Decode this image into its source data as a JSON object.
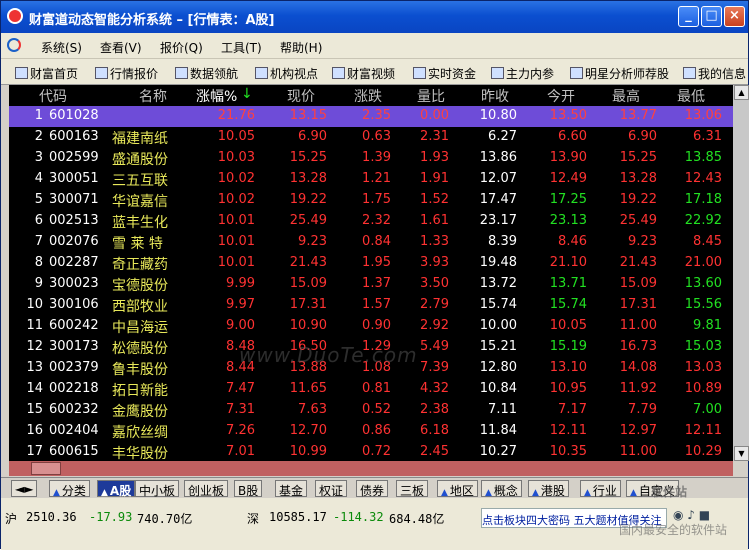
{
  "window": {
    "title": "财富道动态智能分析系统 – [行情表：A股]",
    "buttons": [
      "_",
      "□",
      "×"
    ]
  },
  "menu": [
    "系统(S)",
    "查看(V)",
    "报价(Q)",
    "工具(T)",
    "帮助(H)"
  ],
  "toolbar": [
    "财富首页",
    "行情报价",
    "数据领航",
    "机构视点",
    "财富视频",
    "实时资金",
    "主力内参",
    "明星分析师荐股",
    "我的信息"
  ],
  "table": {
    "headers": [
      "代码",
      "名称",
      "涨幅%",
      "↓",
      "现价",
      "涨跌",
      "量比",
      "昨收",
      "今开",
      "最高",
      "最低"
    ],
    "rows": [
      {
        "idx": "1",
        "code": "601028",
        "name": "",
        "pct": "21.76",
        "price": "13.15",
        "chg": "2.35",
        "vol": "0.00",
        "prev": "10.80",
        "open": "13.50",
        "high": "13.77",
        "low": "13.06",
        "oc": "red",
        "hc": "red",
        "lc": "red"
      },
      {
        "idx": "2",
        "code": "600163",
        "name": "福建南纸",
        "pct": "10.05",
        "price": "6.90",
        "chg": "0.63",
        "vol": "2.31",
        "prev": "6.27",
        "open": "6.60",
        "high": "6.90",
        "low": "6.31",
        "oc": "red",
        "hc": "red",
        "lc": "red"
      },
      {
        "idx": "3",
        "code": "002599",
        "name": "盛通股份",
        "pct": "10.03",
        "price": "15.25",
        "chg": "1.39",
        "vol": "1.93",
        "prev": "13.86",
        "open": "13.90",
        "high": "15.25",
        "low": "13.85",
        "oc": "red",
        "hc": "red",
        "lc": "green"
      },
      {
        "idx": "4",
        "code": "300051",
        "name": "三五互联",
        "pct": "10.02",
        "price": "13.28",
        "chg": "1.21",
        "vol": "1.91",
        "prev": "12.07",
        "open": "12.49",
        "high": "13.28",
        "low": "12.43",
        "oc": "red",
        "hc": "red",
        "lc": "red"
      },
      {
        "idx": "5",
        "code": "300071",
        "name": "华谊嘉信",
        "pct": "10.02",
        "price": "19.22",
        "chg": "1.75",
        "vol": "1.52",
        "prev": "17.47",
        "open": "17.25",
        "high": "19.22",
        "low": "17.18",
        "oc": "green",
        "hc": "red",
        "lc": "green"
      },
      {
        "idx": "6",
        "code": "002513",
        "name": "蓝丰生化",
        "pct": "10.01",
        "price": "25.49",
        "chg": "2.32",
        "vol": "1.61",
        "prev": "23.17",
        "open": "23.13",
        "high": "25.49",
        "low": "22.92",
        "oc": "green",
        "hc": "red",
        "lc": "green"
      },
      {
        "idx": "7",
        "code": "002076",
        "name": "雪 莱 特",
        "pct": "10.01",
        "price": "9.23",
        "chg": "0.84",
        "vol": "1.33",
        "prev": "8.39",
        "open": "8.46",
        "high": "9.23",
        "low": "8.45",
        "oc": "red",
        "hc": "red",
        "lc": "red"
      },
      {
        "idx": "8",
        "code": "002287",
        "name": "奇正藏药",
        "pct": "10.01",
        "price": "21.43",
        "chg": "1.95",
        "vol": "3.93",
        "prev": "19.48",
        "open": "21.10",
        "high": "21.43",
        "low": "21.00",
        "oc": "red",
        "hc": "red",
        "lc": "red"
      },
      {
        "idx": "9",
        "code": "300023",
        "name": "宝德股份",
        "pct": "9.99",
        "price": "15.09",
        "chg": "1.37",
        "vol": "3.50",
        "prev": "13.72",
        "open": "13.71",
        "high": "15.09",
        "low": "13.60",
        "oc": "green",
        "hc": "red",
        "lc": "green"
      },
      {
        "idx": "10",
        "code": "300106",
        "name": "西部牧业",
        "pct": "9.97",
        "price": "17.31",
        "chg": "1.57",
        "vol": "2.79",
        "prev": "15.74",
        "open": "15.74",
        "high": "17.31",
        "low": "15.56",
        "oc": "green",
        "hc": "red",
        "lc": "green"
      },
      {
        "idx": "11",
        "code": "600242",
        "name": "中昌海运",
        "pct": "9.00",
        "price": "10.90",
        "chg": "0.90",
        "vol": "2.92",
        "prev": "10.00",
        "open": "10.05",
        "high": "11.00",
        "low": "9.81",
        "oc": "red",
        "hc": "red",
        "lc": "green"
      },
      {
        "idx": "12",
        "code": "300173",
        "name": "松德股份",
        "pct": "8.48",
        "price": "16.50",
        "chg": "1.29",
        "vol": "5.49",
        "prev": "15.21",
        "open": "15.19",
        "high": "16.73",
        "low": "15.03",
        "oc": "green",
        "hc": "red",
        "lc": "green"
      },
      {
        "idx": "13",
        "code": "002379",
        "name": "鲁丰股份",
        "pct": "8.44",
        "price": "13.88",
        "chg": "1.08",
        "vol": "7.39",
        "prev": "12.80",
        "open": "13.10",
        "high": "14.08",
        "low": "13.03",
        "oc": "red",
        "hc": "red",
        "lc": "red"
      },
      {
        "idx": "14",
        "code": "002218",
        "name": "拓日新能",
        "pct": "7.47",
        "price": "11.65",
        "chg": "0.81",
        "vol": "4.32",
        "prev": "10.84",
        "open": "10.95",
        "high": "11.92",
        "low": "10.89",
        "oc": "red",
        "hc": "red",
        "lc": "red"
      },
      {
        "idx": "15",
        "code": "600232",
        "name": "金鹰股份",
        "pct": "7.31",
        "price": "7.63",
        "chg": "0.52",
        "vol": "2.38",
        "prev": "7.11",
        "open": "7.17",
        "high": "7.79",
        "low": "7.00",
        "oc": "red",
        "hc": "red",
        "lc": "green"
      },
      {
        "idx": "16",
        "code": "002404",
        "name": "嘉欣丝绸",
        "pct": "7.26",
        "price": "12.70",
        "chg": "0.86",
        "vol": "6.18",
        "prev": "11.84",
        "open": "12.11",
        "high": "12.97",
        "low": "12.11",
        "oc": "red",
        "hc": "red",
        "lc": "red"
      },
      {
        "idx": "17",
        "code": "600615",
        "name": "丰华股份",
        "pct": "7.01",
        "price": "10.99",
        "chg": "0.72",
        "vol": "2.45",
        "prev": "10.27",
        "open": "10.35",
        "high": "11.00",
        "low": "10.29",
        "oc": "red",
        "hc": "red",
        "lc": "red"
      }
    ]
  },
  "tabs": [
    {
      "label": "分类",
      "tri": true
    },
    {
      "label": "A股",
      "tri": true,
      "active": true
    },
    {
      "label": "中小板"
    },
    {
      "label": "创业板"
    },
    {
      "label": "B股"
    },
    {
      "label": "基金"
    },
    {
      "label": "权证"
    },
    {
      "label": "债券"
    },
    {
      "label": "三板"
    },
    {
      "label": "地区",
      "tri": true
    },
    {
      "label": "概念",
      "tri": true
    },
    {
      "label": "港股",
      "tri": true
    },
    {
      "label": "行业",
      "tri": true
    },
    {
      "label": "自定义",
      "tri": true
    }
  ],
  "status": {
    "sh_label": "沪",
    "sh_index": "2510.36",
    "sh_change": "-17.93",
    "sh_amount": "740.70亿",
    "sz_label": "深",
    "sz_index": "10585.17",
    "sz_change": "-114.32",
    "sz_amount": "684.48亿",
    "marquee": "点击板块四大密码  五大题材值得关注"
  },
  "watermarks": [
    "www.DuoTe.com",
    "软件站",
    "国内最安全的软件站"
  ],
  "colors": {
    "up": "#ff3232",
    "down": "#22e022",
    "selected_row": "#6e4cd8",
    "name": "#e8e85a"
  }
}
